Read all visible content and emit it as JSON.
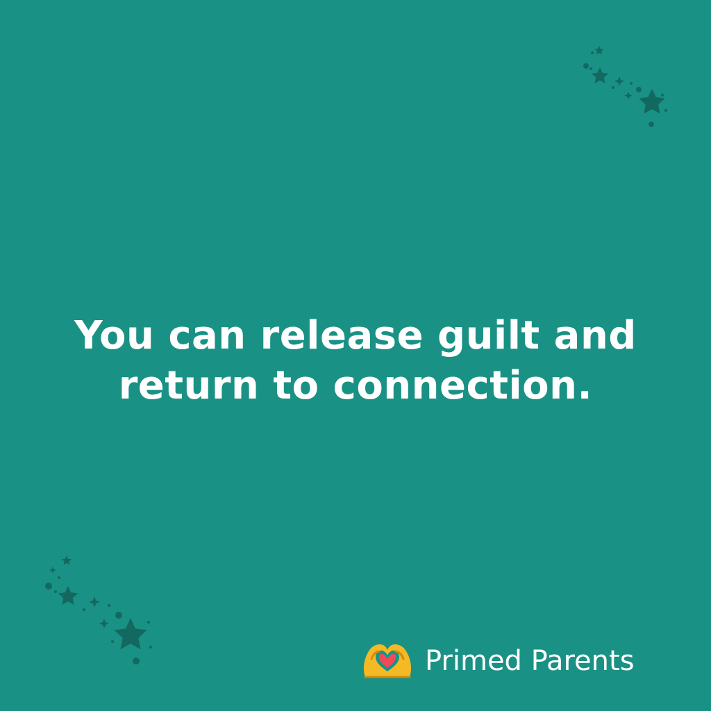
{
  "quote": {
    "line1": "You can release guilt and",
    "line2": "return to connection."
  },
  "brand": {
    "name": "Primed Parents",
    "logo_icon": "heart-hands-icon"
  },
  "decorations": {
    "icon": "star-cluster-icon"
  },
  "colors": {
    "background": "#1a9185",
    "text": "#ffffff",
    "stars": "#13695f",
    "logo": "#f5b926"
  }
}
